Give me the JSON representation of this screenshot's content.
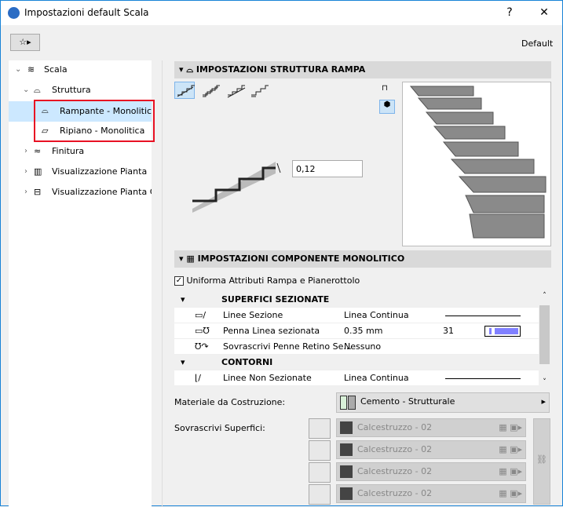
{
  "window": {
    "title": "Impostazioni default Scala",
    "help": "?",
    "close": "✕",
    "default_label": "Default"
  },
  "tree": [
    {
      "label": "Scala",
      "expanded": true
    },
    {
      "label": "Struttura",
      "expanded": true
    },
    {
      "label": "Rampante - Monolitica",
      "selected": true
    },
    {
      "label": "Ripiano - Monolitica"
    },
    {
      "label": "Finitura"
    },
    {
      "label": "Visualizzazione Pianta"
    },
    {
      "label": "Visualizzazione Pianta Co"
    }
  ],
  "ramp": {
    "header": "IMPOSTAZIONI STRUTTURA RAMPA",
    "thickness": "0,12"
  },
  "mono": {
    "header": "IMPOSTAZIONI COMPONENTE MONOLITICO",
    "uniform_label": "Uniforma Attributi Rampa e Pianerottolo",
    "uniform_checked": true
  },
  "table": {
    "group1": "SUPERFICI SEZIONATE",
    "rows1": [
      {
        "label": "Linee Sezione",
        "value": "Linea Continua"
      },
      {
        "label": "Penna Linea sezionata",
        "value": "0.35 mm",
        "pen": "31",
        "pen_color": "#8080ff"
      },
      {
        "label": "Sovrascrivi Penne Retino Se...",
        "value": "Nessuno"
      }
    ],
    "group2": "CONTORNI",
    "rows2": [
      {
        "label": "Linee Non Sezionate",
        "value": "Linea Continua"
      }
    ]
  },
  "material": {
    "label": "Materiale da Costruzione:",
    "value": "Cemento - Strutturale"
  },
  "surfaces": {
    "label": "Sovrascrivi Superfici:",
    "items": [
      "Calcestruzzo - 02",
      "Calcestruzzo - 02",
      "Calcestruzzo - 02",
      "Calcestruzzo - 02"
    ]
  },
  "colors": {
    "selection": "#cce8ff",
    "highlight_border": "#e81123"
  }
}
